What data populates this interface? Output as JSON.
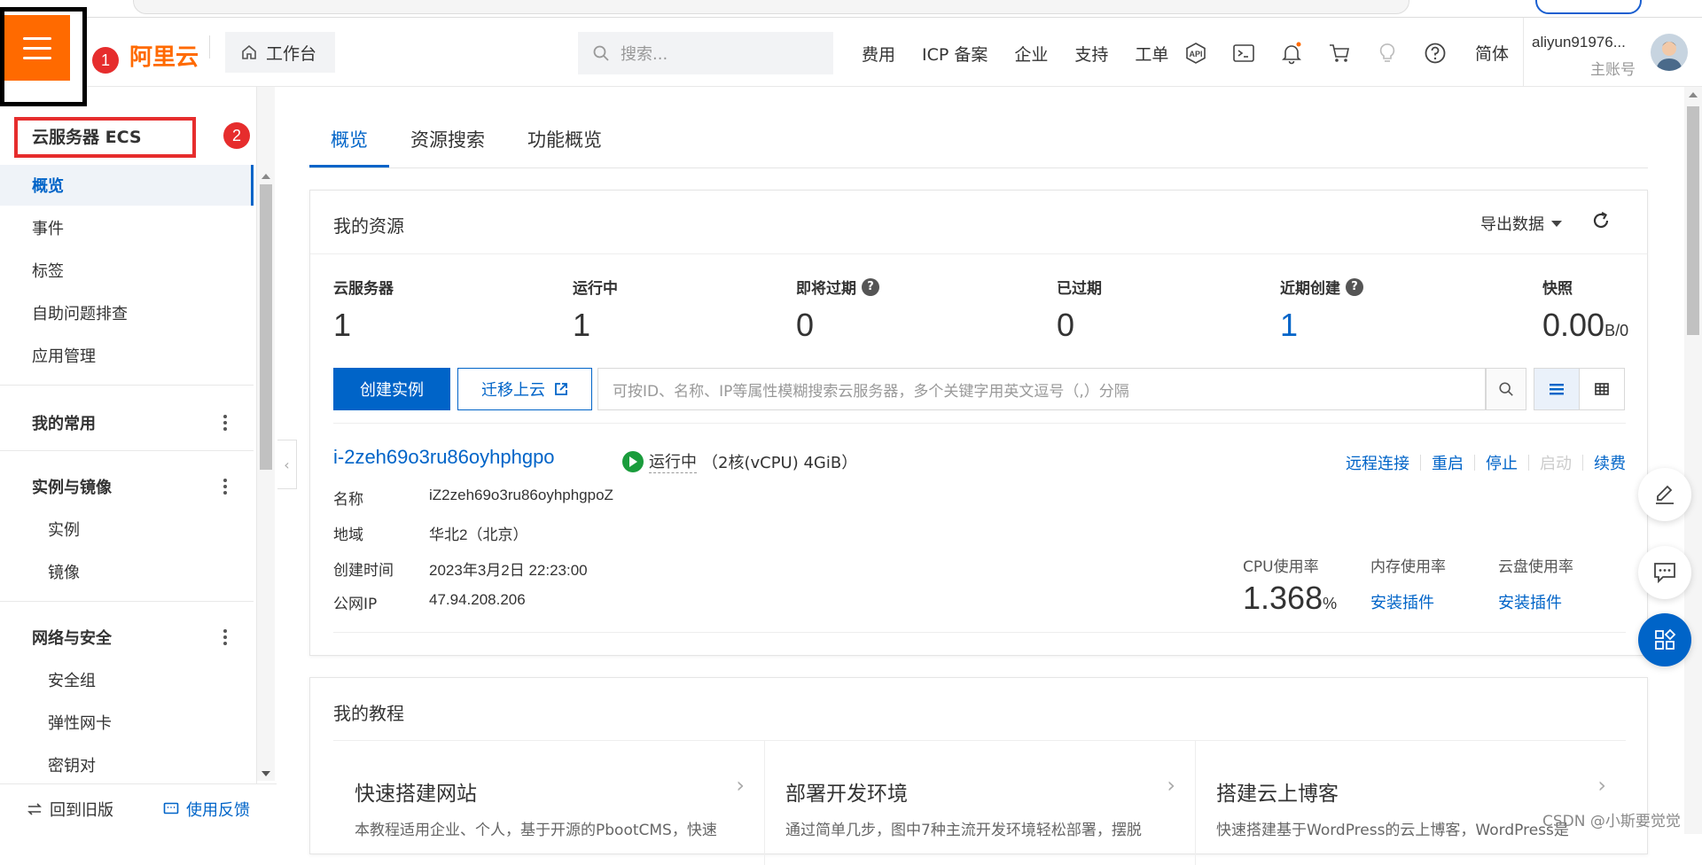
{
  "topnav": {
    "logo_text": "阿里云",
    "workbench_label": "工作台",
    "search_placeholder": "搜索...",
    "links": [
      "费用",
      "ICP 备案",
      "企业",
      "支持",
      "工单"
    ],
    "icons": [
      "api-icon",
      "terminal-icon",
      "bell-icon",
      "cart-icon",
      "lightbulb-icon",
      "help-icon"
    ],
    "language": "简体",
    "user_name": "aliyun91976...",
    "user_role": "主账号",
    "annotation_1": "1"
  },
  "sidebar": {
    "title": "云服务器 ECS",
    "annotation_2": "2",
    "items": [
      {
        "label": "概览",
        "active": true
      },
      {
        "label": "事件"
      },
      {
        "label": "标签"
      },
      {
        "label": "自助问题排查"
      },
      {
        "label": "应用管理"
      }
    ],
    "groups": [
      {
        "label": "我的常用",
        "items": []
      },
      {
        "label": "实例与镜像",
        "items": [
          "实例",
          "镜像"
        ]
      },
      {
        "label": "网络与安全",
        "items": [
          "安全组",
          "弹性网卡",
          "密钥对"
        ]
      }
    ],
    "footer_old": "回到旧版",
    "footer_feedback": "使用反馈"
  },
  "tabs": [
    "概览",
    "资源搜索",
    "功能概览"
  ],
  "resources": {
    "title": "我的资源",
    "export_label": "导出数据",
    "stats": [
      {
        "label": "云服务器",
        "value": "1"
      },
      {
        "label": "运行中",
        "value": "1"
      },
      {
        "label": "即将过期",
        "value": "0",
        "help": true
      },
      {
        "label": "已过期",
        "value": "0"
      },
      {
        "label": "近期创建",
        "value": "1",
        "help": true,
        "highlight": true
      },
      {
        "label": "快照",
        "value": "0.00",
        "unit": "B/0"
      }
    ],
    "create_button": "创建实例",
    "migrate_button": "迁移上云",
    "search_placeholder": "可按ID、名称、IP等属性模糊搜索云服务器，多个关键字用英文逗号（,）分隔"
  },
  "instance": {
    "id": "i-2zeh69o3ru86oyhphgpo",
    "status": "运行中",
    "spec": "（2核(vCPU) 4GiB）",
    "actions": [
      {
        "label": "远程连接",
        "enabled": true
      },
      {
        "label": "重启",
        "enabled": true
      },
      {
        "label": "停止",
        "enabled": true
      },
      {
        "label": "启动",
        "enabled": false
      },
      {
        "label": "续费",
        "enabled": true
      }
    ],
    "fields": [
      {
        "key": "名称",
        "value": "iZ2zeh69o3ru86oyhphgpoZ"
      },
      {
        "key": "地域",
        "value": "华北2（北京）"
      },
      {
        "key": "创建时间",
        "value": "2023年3月2日 22:23:00"
      },
      {
        "key": "公网IP",
        "value": "47.94.208.206"
      }
    ],
    "cpu_label": "CPU使用率",
    "cpu_value": "1.368",
    "cpu_unit": "%",
    "mem_label": "内存使用率",
    "mem_link": "安装插件",
    "disk_label": "云盘使用率",
    "disk_link": "安装插件"
  },
  "tutorials": {
    "title": "我的教程",
    "items": [
      {
        "title": "快速搭建网站",
        "desc": "本教程适用企业、个人，基于开源的PbootCMS，快速"
      },
      {
        "title": "部署开发环境",
        "desc": "通过简单几步，图中7种主流开发环境轻松部署，摆脱"
      },
      {
        "title": "搭建云上博客",
        "desc": "快速搭建基于WordPress的云上博客，WordPress是"
      }
    ]
  },
  "watermark": "CSDN @小斯要觉觉",
  "colors": {
    "brand": "#ff6a00",
    "primary": "#0064c8",
    "running": "#1a9c3c",
    "annotation": "#e62d2d"
  }
}
